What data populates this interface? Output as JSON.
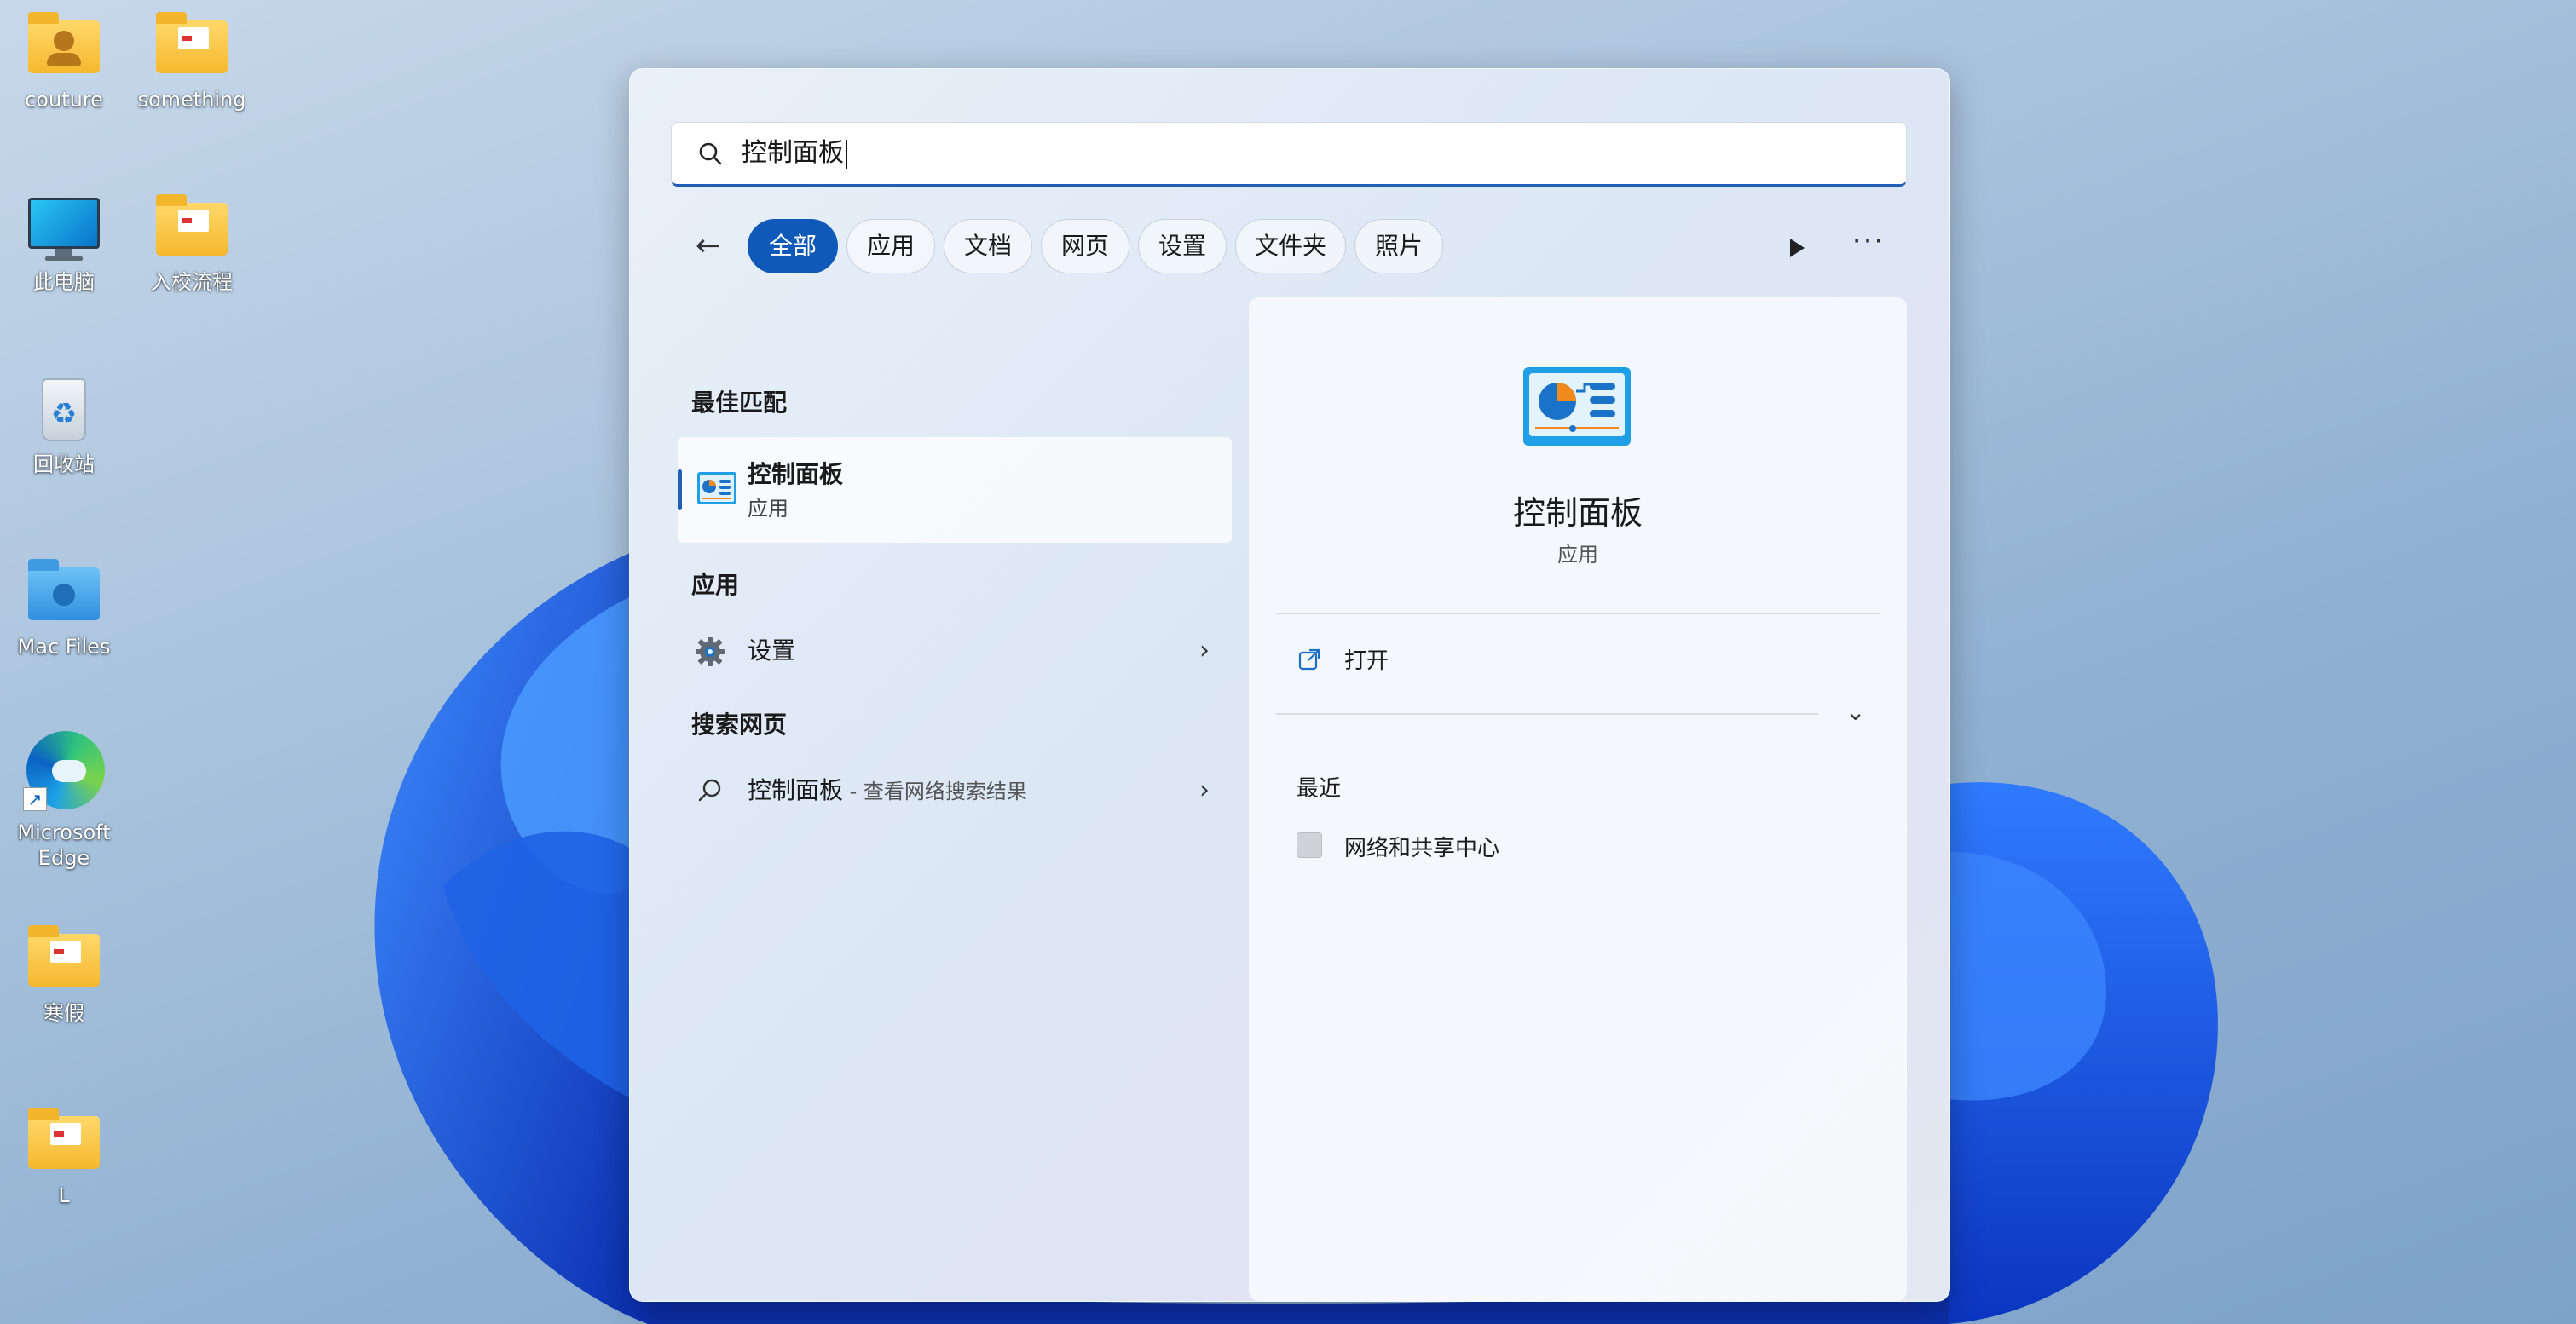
{
  "desktop": {
    "icons": [
      {
        "label": "couture"
      },
      {
        "label": "something"
      },
      {
        "label": "此电脑"
      },
      {
        "label": "入校流程"
      },
      {
        "label": "回收站"
      },
      {
        "label": "Mac Files"
      },
      {
        "label": "Microsoft Edge"
      },
      {
        "label": "寒假"
      },
      {
        "label": "L"
      }
    ]
  },
  "search": {
    "query": "控制面板",
    "filters": [
      "全部",
      "应用",
      "文档",
      "网页",
      "设置",
      "文件夹",
      "照片"
    ],
    "active_filter": "全部"
  },
  "results": {
    "best_match_title": "最佳匹配",
    "best_match": {
      "name": "控制面板",
      "type": "应用",
      "icon": "control-panel-icon"
    },
    "apps_title": "应用",
    "apps": [
      {
        "name": "设置",
        "icon": "gear-icon"
      }
    ],
    "web_title": "搜索网页",
    "web": [
      {
        "name": "控制面板",
        "suffix": " - 查看网络搜索结果",
        "icon": "search-icon"
      }
    ]
  },
  "detail": {
    "title": "控制面板",
    "type": "应用",
    "action_open": "打开",
    "recent_title": "最近",
    "recent": [
      {
        "name": "网络和共享中心"
      }
    ]
  },
  "colors": {
    "accent": "#0f5ab8",
    "bloom": "#0b4fd6"
  }
}
